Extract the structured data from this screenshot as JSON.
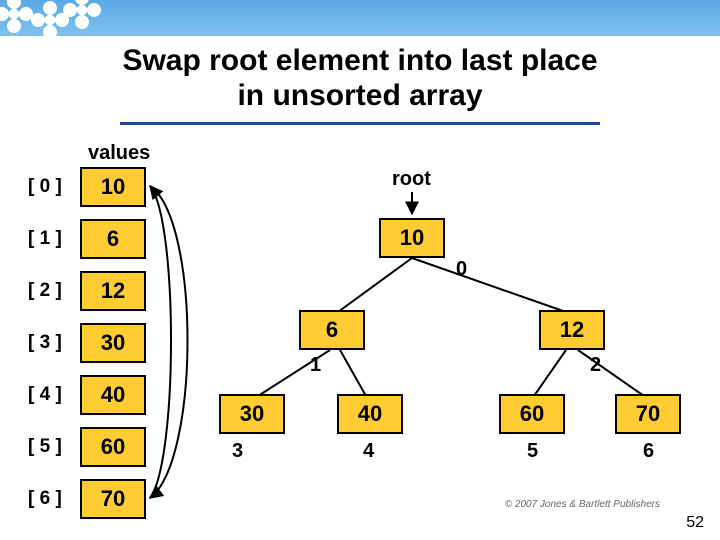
{
  "title_line1": "Swap root element into last place",
  "title_line2": "in unsorted array",
  "values_label": "values",
  "root_label": "root",
  "array": [
    {
      "idx": "[ 0 ]",
      "val": "10"
    },
    {
      "idx": "[ 1 ]",
      "val": "6"
    },
    {
      "idx": "[ 2 ]",
      "val": "12"
    },
    {
      "idx": "[ 3 ]",
      "val": "30"
    },
    {
      "idx": "[ 4 ]",
      "val": "40"
    },
    {
      "idx": "[ 5 ]",
      "val": "60"
    },
    {
      "idx": "[ 6 ]",
      "val": "70"
    }
  ],
  "tree": {
    "n0": {
      "val": "10",
      "idx": "0"
    },
    "n1": {
      "val": "6",
      "idx": "1"
    },
    "n2": {
      "val": "12",
      "idx": "2"
    },
    "n3": {
      "val": "30",
      "idx": "3"
    },
    "n4": {
      "val": "40",
      "idx": "4"
    },
    "n5": {
      "val": "60",
      "idx": "5"
    },
    "n6": {
      "val": "70",
      "idx": "6"
    }
  },
  "slide_number": "52",
  "copyright": "© 2007 Jones & Bartlett Publishers"
}
